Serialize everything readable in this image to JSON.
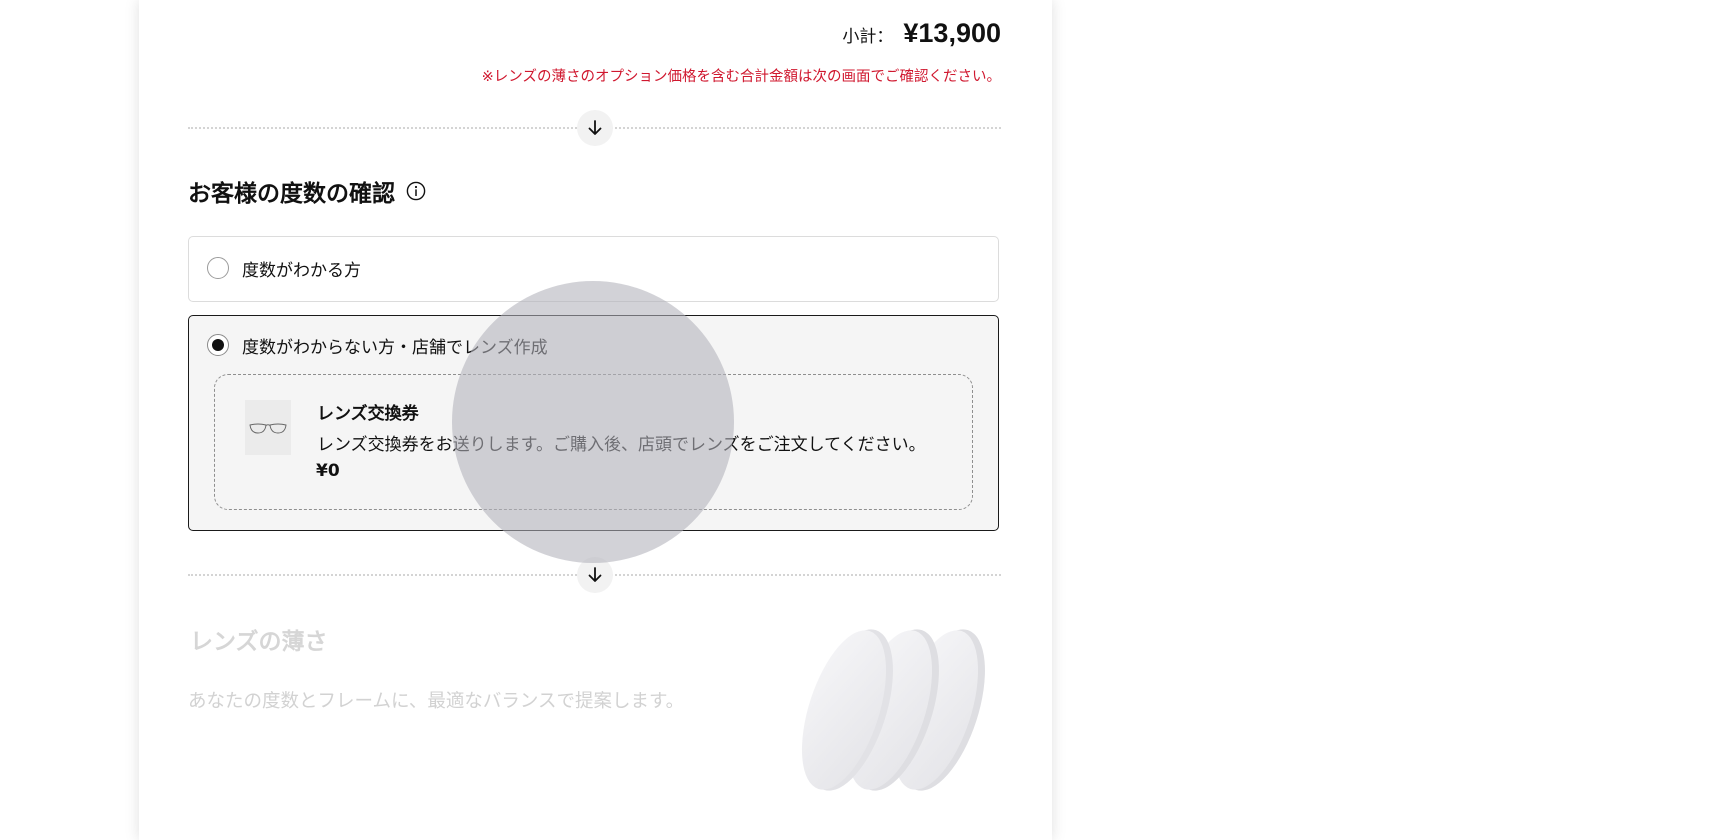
{
  "subtotal": {
    "label": "小計：",
    "value": "¥13,900"
  },
  "option_note": "※レンズの薄さのオプション価格を含む合計金額は次の画面でご確認ください。",
  "prescription_section": {
    "title": "お客様の度数の確認",
    "info_icon": "info-icon",
    "options": [
      {
        "label": "度数がわかる方",
        "selected": false
      },
      {
        "label": "度数がわからない方・店舗でレンズ作成",
        "selected": true
      }
    ],
    "voucher": {
      "thumbnail_icon": "glasses-icon",
      "title": "レンズ交換券",
      "description": "レンズ交換券をお送りします。ご購入後、店頭でレンズをご注文してください。",
      "price": "¥0"
    }
  },
  "thickness_section": {
    "title": "レンズの薄さ",
    "description": "あなたの度数とフレームに、最適なバランスで提案します。",
    "image_icon": "lenses-illustration",
    "enabled": false
  },
  "colors": {
    "note_red": "#d0182f",
    "selected_border": "#1a1a1a",
    "disabled_text": "#d6d6d6"
  }
}
